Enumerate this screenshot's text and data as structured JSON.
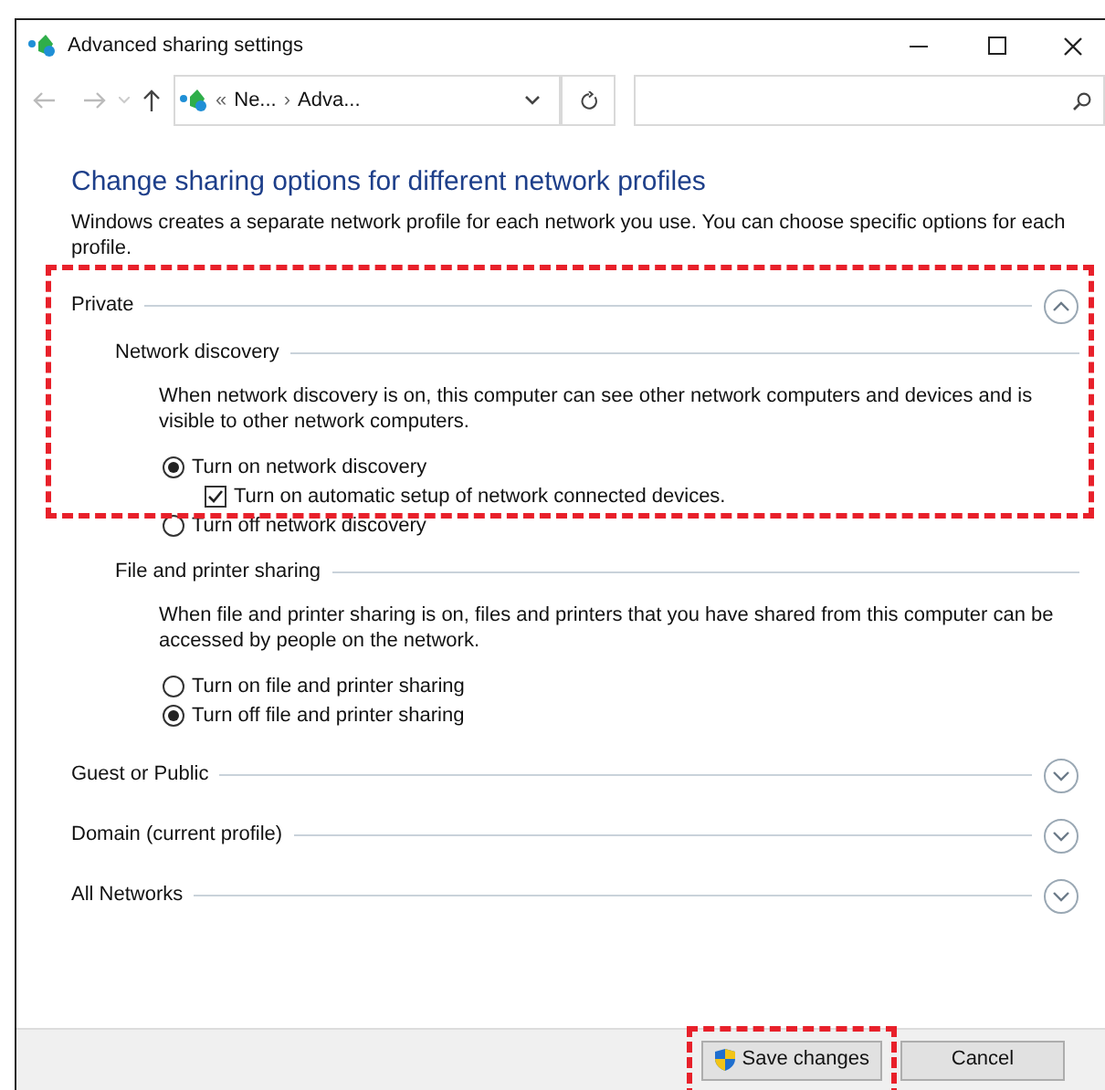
{
  "window": {
    "title": "Advanced sharing settings"
  },
  "address_bar": {
    "prefix": "«",
    "separator": "›",
    "items": [
      "Ne...",
      "Adva..."
    ]
  },
  "heading": "Change sharing options for different network profiles",
  "intro": "Windows creates a separate network profile for each network you use. You can choose specific options for each profile.",
  "sections": [
    {
      "title": "Private",
      "expanded": true,
      "highlighted": true,
      "groups": [
        {
          "title": "Network discovery",
          "description": "When network discovery is on, this computer can see other network computers and devices and is visible to other network computers.",
          "options": [
            {
              "kind": "radio",
              "label": "Turn on network discovery",
              "selected": true
            },
            {
              "kind": "checkbox",
              "label": "Turn on automatic setup of network connected devices.",
              "checked": true
            },
            {
              "kind": "radio",
              "label": "Turn off network discovery",
              "selected": false
            }
          ]
        },
        {
          "title": "File and printer sharing",
          "description": "When file and printer sharing is on, files and printers that you have shared from this computer can be accessed by people on the network.",
          "options": [
            {
              "kind": "radio",
              "label": "Turn on file and printer sharing",
              "selected": false
            },
            {
              "kind": "radio",
              "label": "Turn off file and printer sharing",
              "selected": true
            }
          ]
        }
      ]
    },
    {
      "title": "Guest or Public",
      "expanded": false,
      "highlighted": false
    },
    {
      "title": "Domain (current profile)",
      "expanded": false,
      "highlighted": false
    },
    {
      "title": "All Networks",
      "expanded": false,
      "highlighted": false
    }
  ],
  "buttons": [
    {
      "kind": "shield",
      "label": "Save changes",
      "highlighted": true
    },
    {
      "kind": "plain",
      "label": "Cancel",
      "highlighted": false
    }
  ]
}
